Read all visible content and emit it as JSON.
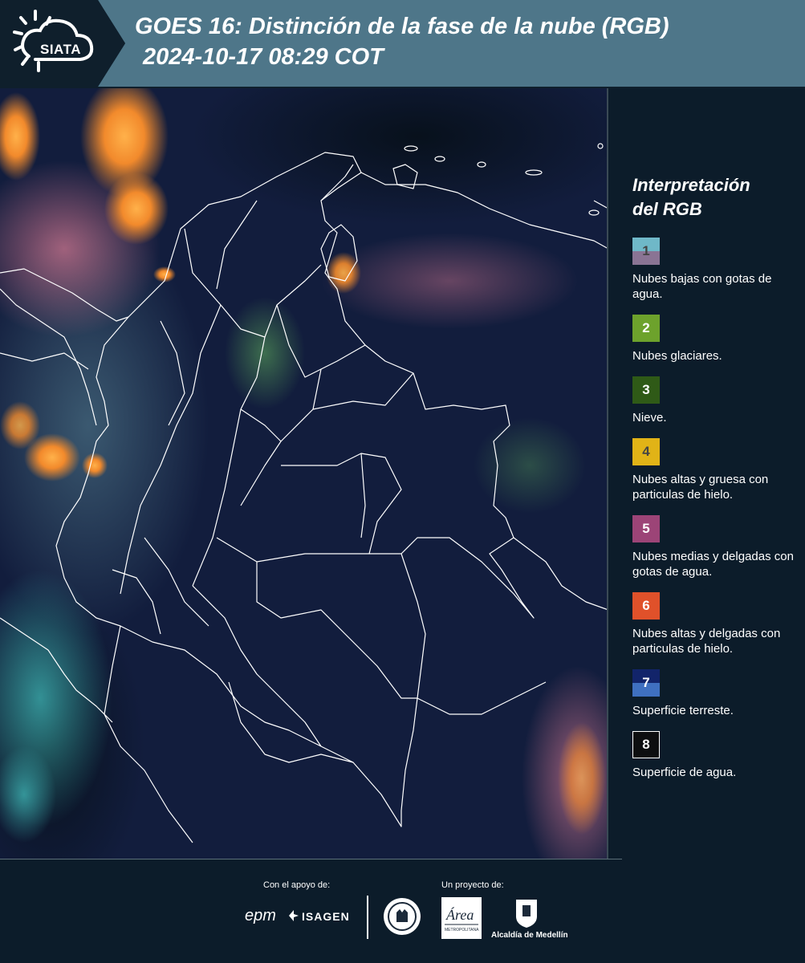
{
  "header": {
    "logo_text": "SIATA",
    "title_line1": "GOES 16: Distinción de la fase de la nube (RGB)",
    "title_line2": "2024-10-17 08:29 COT"
  },
  "legend": {
    "title_line1": "Interpretación",
    "title_line2": "del RGB",
    "items": [
      {
        "num": "1",
        "label": "Nubes bajas con gotas de agua.",
        "color_top": "#6fb8c8",
        "color_bottom": "#8a7494",
        "num_color": "#444444"
      },
      {
        "num": "2",
        "label": "Nubes glaciares.",
        "color": "#6da22c",
        "num_color": "#ffffff"
      },
      {
        "num": "3",
        "label": "Nieve.",
        "color": "#2f5a17",
        "num_color": "#ffffff"
      },
      {
        "num": "4",
        "label": "Nubes altas y gruesa con particulas de hielo.",
        "color": "#e1b317",
        "num_color": "#444444"
      },
      {
        "num": "5",
        "label": "Nubes medias y delgadas con gotas de agua.",
        "color": "#9c4477",
        "num_color": "#ffffff"
      },
      {
        "num": "6",
        "label": "Nubes altas y delgadas con particulas de hielo.",
        "color": "#e0512a",
        "num_color": "#ffffff"
      },
      {
        "num": "7",
        "label": "Superficie terreste.",
        "color_top": "#12246a",
        "color_bottom": "#3f70c0",
        "num_color": "#ffffff"
      },
      {
        "num": "8",
        "label": "Superficie de agua.",
        "color": "#0d0e10",
        "num_color": "#ffffff",
        "border": "#ffffff"
      }
    ]
  },
  "footer": {
    "support_label": "Con el apoyo de:",
    "project_label": "Un proyecto de:",
    "epm": "epm",
    "isagen": "ISAGEN",
    "metro_text": "Área",
    "metro_sub": "METROPOLITANA",
    "alcaldia": "Alcaldía de Medellín"
  }
}
